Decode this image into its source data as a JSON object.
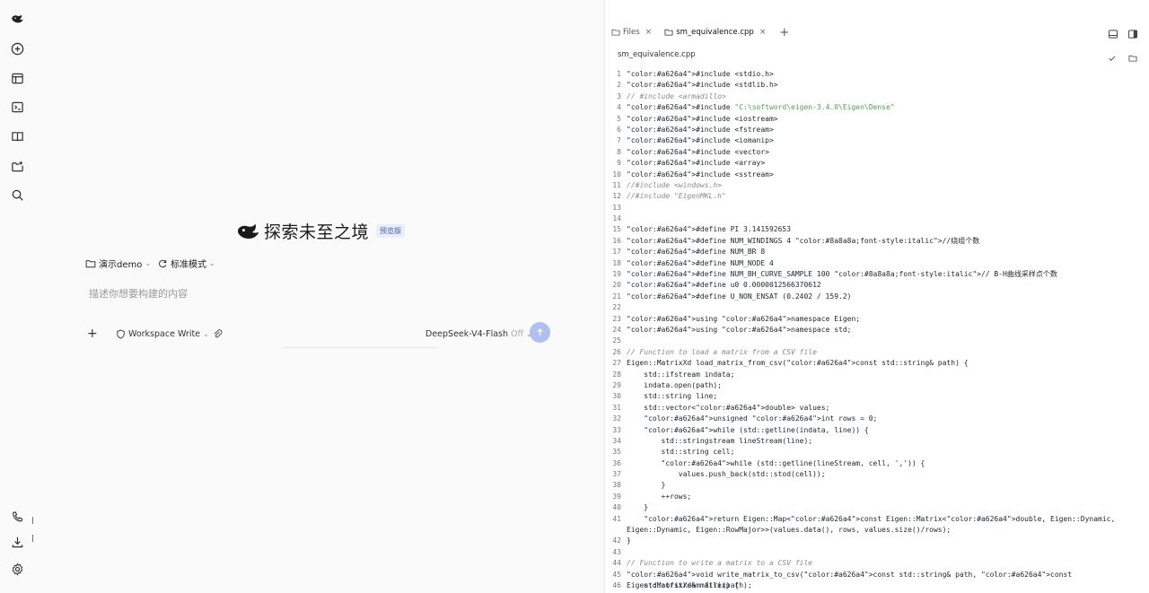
{
  "hero": {
    "title": "探索未至之境",
    "badge": "预览版"
  },
  "meta": {
    "project": "演示demo",
    "mode": "标准模式"
  },
  "composer": {
    "placeholder": "描述你想要构建的内容",
    "add": "+",
    "permission": "Workspace Write",
    "model": "DeepSeek-V4-Flash",
    "thinking": "Off"
  },
  "sidebar_ticks": [
    "|",
    "|"
  ],
  "editor": {
    "tabs": [
      {
        "label": "Files",
        "close": "×"
      },
      {
        "label": "sm_equivalence.cpp",
        "close": "×"
      }
    ],
    "add_tab": "+",
    "file_path": "sm_equivalence.cpp",
    "lines": [
      {
        "n": "1",
        "text": "#include <stdio.h>"
      },
      {
        "n": "2",
        "text": "#include <stdlib.h>"
      },
      {
        "n": "3",
        "text": "// #include <armadillo>"
      },
      {
        "n": "4",
        "text": "#include \"C:\\softword\\eigen-3.4.0\\Eigen\\Dense\""
      },
      {
        "n": "5",
        "text": "#include <iostream>"
      },
      {
        "n": "6",
        "text": "#include <fstream>"
      },
      {
        "n": "7",
        "text": "#include <iomanip>"
      },
      {
        "n": "8",
        "text": "#include <vector>"
      },
      {
        "n": "9",
        "text": "#include <array>"
      },
      {
        "n": "10",
        "text": "#include <sstream>"
      },
      {
        "n": "11",
        "text": "//#include <windows.h>"
      },
      {
        "n": "12",
        "text": "//#include \"EigenMKL.h\""
      },
      {
        "n": "13",
        "text": ""
      },
      {
        "n": "14",
        "text": ""
      },
      {
        "n": "15",
        "text": "#define PI 3.141592653"
      },
      {
        "n": "16",
        "text": "#define NUM_WINDINGS 4 //绕组个数"
      },
      {
        "n": "17",
        "text": "#define NUM_BR 8"
      },
      {
        "n": "18",
        "text": "#define NUM_NODE 4"
      },
      {
        "n": "19",
        "text": "#define NUM_BH_CURVE_SAMPLE 100 // B-H曲线采样点个数"
      },
      {
        "n": "20",
        "text": "#define u0 0.0000012566370612"
      },
      {
        "n": "21",
        "text": "#define U_NON_ENSAT (0.2402 / 159.2)"
      },
      {
        "n": "22",
        "text": ""
      },
      {
        "n": "23",
        "text": "using namespace Eigen;"
      },
      {
        "n": "24",
        "text": "using namespace std;"
      },
      {
        "n": "25",
        "text": ""
      },
      {
        "n": "26",
        "text": "// Function to load a matrix from a CSV file"
      },
      {
        "n": "27",
        "text": "Eigen::MatrixXd load_matrix_from_csv(const std::string& path) {"
      },
      {
        "n": "28",
        "text": "    std::ifstream indata;"
      },
      {
        "n": "29",
        "text": "    indata.open(path);"
      },
      {
        "n": "30",
        "text": "    std::string line;"
      },
      {
        "n": "31",
        "text": "    std::vector<double> values;"
      },
      {
        "n": "32",
        "text": "    unsigned int rows = 0;"
      },
      {
        "n": "33",
        "text": "    while (std::getline(indata, line)) {"
      },
      {
        "n": "34",
        "text": "        std::stringstream lineStream(line);"
      },
      {
        "n": "35",
        "text": "        std::string cell;"
      },
      {
        "n": "36",
        "text": "        while (std::getline(lineStream, cell, ',')) {"
      },
      {
        "n": "37",
        "text": "            values.push_back(std::stod(cell));"
      },
      {
        "n": "38",
        "text": "        }"
      },
      {
        "n": "39",
        "text": "        ++rows;"
      },
      {
        "n": "40",
        "text": "    }"
      },
      {
        "n": "41",
        "text": "    return Eigen::Map<const Eigen::Matrix<double, Eigen::Dynamic, Eigen::Dynamic, Eigen::RowMajor>>(values.data(), rows, values.size()/rows);"
      },
      {
        "n": "42",
        "text": "}"
      },
      {
        "n": "43",
        "text": ""
      },
      {
        "n": "44",
        "text": "// Function to write a matrix to a CSV file"
      },
      {
        "n": "45",
        "text": "void write_matrix_to_csv(const std::string& path, const Eigen::MatrixXd& matrix) {"
      },
      {
        "n": "46",
        "text": "    std::ofstream file(path);"
      }
    ]
  }
}
